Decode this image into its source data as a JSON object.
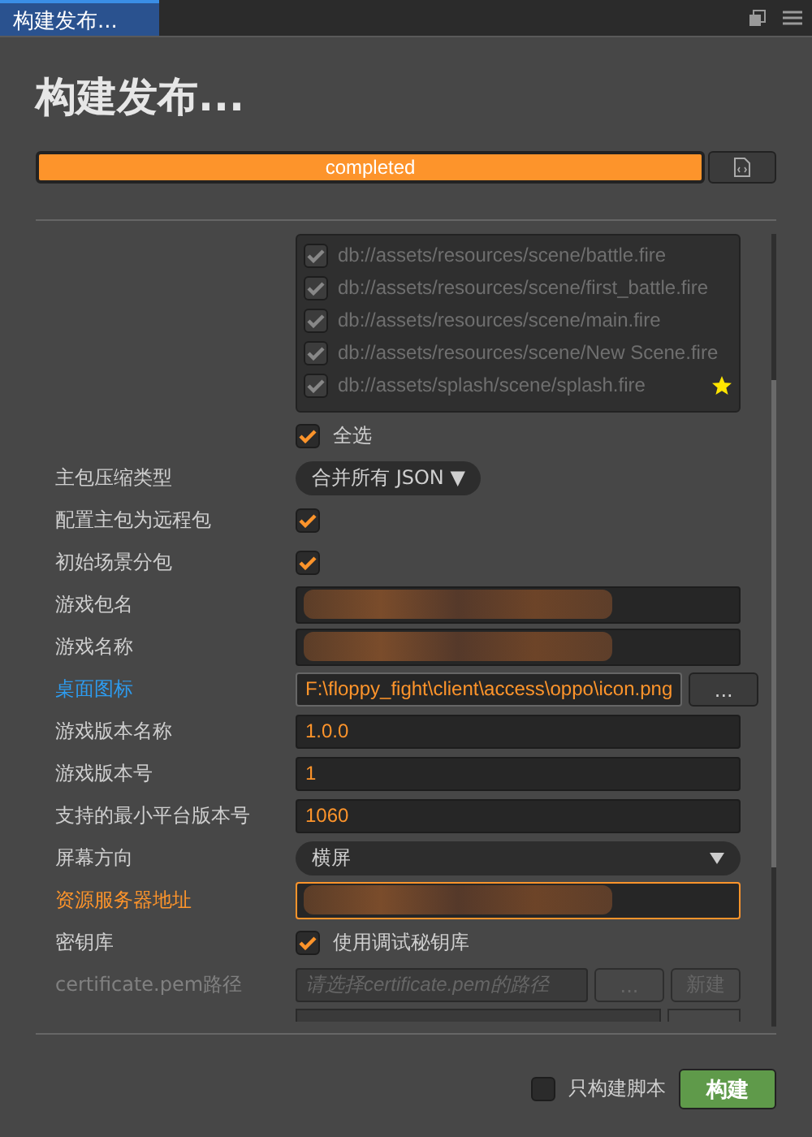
{
  "tab": {
    "title": "构建发布...",
    "selected": true
  },
  "heading": "构建发布...",
  "progress": {
    "label": "completed",
    "level": 1
  },
  "rows": [
    {
      "kind": "scenes",
      "scenes": [
        {
          "path": "db://assets/resources/scene/battle.fire",
          "checked": true,
          "starred": false
        },
        {
          "path": "db://assets/resources/scene/first_battle.fire",
          "checked": true,
          "starred": false
        },
        {
          "path": "db://assets/resources/scene/main.fire",
          "checked": true,
          "starred": false
        },
        {
          "path": "db://assets/resources/scene/New Scene.fire",
          "checked": true,
          "starred": false
        },
        {
          "path": "db://assets/splash/scene/splash.fire",
          "checked": true,
          "starred": true
        }
      ]
    },
    {
      "kind": "checkbox",
      "option": "全选",
      "checked": true
    },
    {
      "kind": "combo",
      "hovered": false,
      "focused": false,
      "disabled": false,
      "label": "主包压缩类型",
      "value": "合并所有 JSON ▼"
    },
    {
      "kind": "checkbox",
      "hovered": false,
      "focused": false,
      "disabled": false,
      "label": "配置主包为远程包",
      "checked": true
    },
    {
      "kind": "checkbox",
      "hovered": false,
      "focused": false,
      "disabled": false,
      "label": "初始场景分包",
      "checked": true
    },
    {
      "kind": "redacted",
      "hovered": false,
      "focused": false,
      "disabled": false,
      "label": "游戏包名"
    },
    {
      "kind": "redacted",
      "hovered": false,
      "focused": false,
      "disabled": false,
      "label": "游戏名称"
    },
    {
      "kind": "file",
      "hovered": true,
      "focused": false,
      "disabled": false,
      "label": "桌面图标",
      "value": "F:\\floppy_fight\\client\\access\\oppo\\icon.png",
      "button": "..."
    },
    {
      "kind": "text",
      "hovered": false,
      "focused": false,
      "disabled": false,
      "label": "游戏版本名称",
      "value": "1.0.0"
    },
    {
      "kind": "text",
      "hovered": false,
      "focused": false,
      "disabled": false,
      "label": "游戏版本号",
      "value": "1"
    },
    {
      "kind": "text",
      "hovered": false,
      "focused": false,
      "disabled": false,
      "label": "支持的最小平台版本号",
      "value": "1060"
    },
    {
      "kind": "dropdown",
      "hovered": false,
      "focused": false,
      "disabled": false,
      "label": "屏幕方向",
      "value": "横屏"
    },
    {
      "kind": "redacted",
      "hovered": false,
      "focused": true,
      "disabled": false,
      "label": "资源服务器地址"
    },
    {
      "kind": "checkbox",
      "hovered": false,
      "focused": false,
      "disabled": false,
      "label": "密钥库",
      "option": "使用调试秘钥库",
      "checked": true
    },
    {
      "kind": "file2",
      "hovered": false,
      "focused": false,
      "disabled": true,
      "label": "certificate.pem路径",
      "placeholder": "请选择certificate.pem的路径",
      "button": "...",
      "button2": "新建"
    }
  ],
  "footer": {
    "option": "只构建脚本",
    "checked": false,
    "build": "构建"
  }
}
